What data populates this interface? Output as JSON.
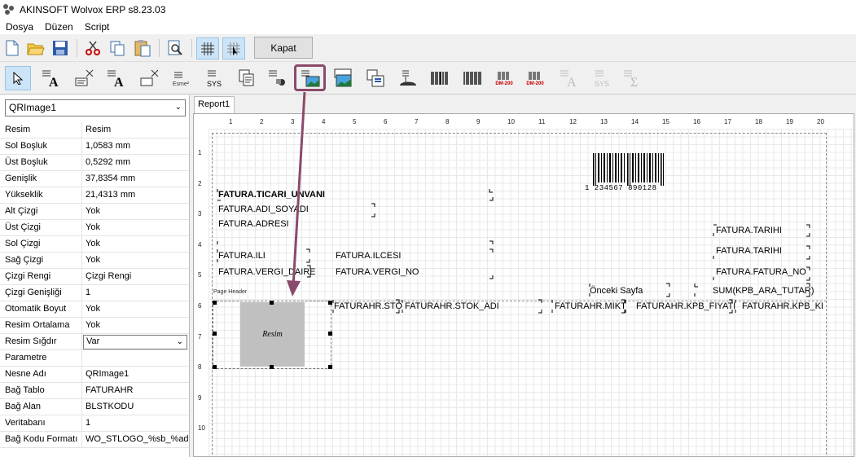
{
  "window": {
    "title": "AKINSOFT Wolvox ERP s8.23.03"
  },
  "menu": [
    "Dosya",
    "Düzen",
    "Script"
  ],
  "toolbar": {
    "close_label": "Kapat",
    "icons": [
      "new-file-icon",
      "open-folder-icon",
      "save-icon",
      "cut-icon",
      "copy-icon",
      "paste-icon",
      "preview-icon",
      "grid-toggle-icon",
      "snap-grid-icon"
    ]
  },
  "components": {
    "items": [
      "pointer",
      "text-label",
      "data-field",
      "expression",
      "sys-data",
      "summary",
      "shape",
      "image",
      "db-image",
      "chart",
      "rich-text",
      "barcode-1",
      "barcode-2",
      "datamatrix-1",
      "datamatrix-2",
      "text-disabled",
      "sys-disabled",
      "sum-disabled"
    ],
    "labels": {
      "esme": "Esme²",
      "sys": "SYS",
      "dm1": "DM-200",
      "dm2": "DM-200",
      "sys2": "SYS"
    }
  },
  "inspector": {
    "selected": "QRImage1",
    "rows": [
      {
        "k": "Resim",
        "v": "Resim"
      },
      {
        "k": "Sol Boşluk",
        "v": "1,0583 mm"
      },
      {
        "k": "Üst Boşluk",
        "v": "0,5292 mm"
      },
      {
        "k": "Genişlik",
        "v": "37,8354 mm"
      },
      {
        "k": "Yükseklik",
        "v": "21,4313 mm"
      },
      {
        "k": "Alt Çizgi",
        "v": "Yok"
      },
      {
        "k": "Üst Çizgi",
        "v": "Yok"
      },
      {
        "k": "Sol Çizgi",
        "v": "Yok"
      },
      {
        "k": "Sağ Çizgi",
        "v": "Yok"
      },
      {
        "k": "Çizgi Rengi",
        "v": "Çizgi Rengi"
      },
      {
        "k": "Çizgi Genişliği",
        "v": "1"
      },
      {
        "k": "Otomatik Boyut",
        "v": "Yok"
      },
      {
        "k": "Resim Ortalama",
        "v": "Yok"
      },
      {
        "k": "Resim Sığdır",
        "v": "Var"
      },
      {
        "k": "Parametre",
        "v": ""
      },
      {
        "k": "Nesne Adı",
        "v": "QRImage1"
      },
      {
        "k": "Bağ Tablo",
        "v": "FATURAHR"
      },
      {
        "k": "Bağ Alan",
        "v": "BLSTKODU"
      },
      {
        "k": "Veritabanı",
        "v": "1"
      },
      {
        "k": "Bağ Kodu Formatı",
        "v": "WO_STLOGO_%sb_%ad"
      }
    ]
  },
  "designer": {
    "tab": "Report1",
    "ruler_top": [
      "1",
      "2",
      "3",
      "4",
      "5",
      "6",
      "7",
      "8",
      "9",
      "10",
      "11",
      "12",
      "13",
      "14",
      "15",
      "16",
      "17",
      "18",
      "19",
      "20"
    ],
    "ruler_left": [
      "1",
      "2",
      "3",
      "4",
      "5",
      "6",
      "7",
      "8",
      "9",
      "10"
    ],
    "barcode_text": "1 234567 890128",
    "fields": {
      "ticari": "FATURA.TICARI_UNVANI",
      "adi": "FATURA.ADI_SOYADI",
      "adres": "FATURA.ADRESI",
      "ili": "FATURA.ILI",
      "ilce": "FATURA.ILCESI",
      "vdaire": "FATURA.VERGI_DAIRE",
      "vno": "FATURA.VERGI_NO",
      "tarih1": "FATURA.TARIHI",
      "tarih2": "FATURA.TARIHI",
      "fno": "FATURA.FATURA_NO",
      "onceki": "Önceki Sayfa",
      "sum": "SUM(KPB_ARA_TUTAR)",
      "pageheader": "Page Header",
      "sto": "FATURAHR.STO",
      "stokadi": "FATURAHR.STOK_ADI",
      "mikt": "FATURAHR.MIKT",
      "fiyat": "FATURAHR.KPB_FIYATI",
      "kd": "FATURAHR.KPB_KD",
      "resim": "Resim"
    }
  },
  "colors": {
    "arrow": "#8b4a6b",
    "highlight_box": "#8b4a6b"
  }
}
